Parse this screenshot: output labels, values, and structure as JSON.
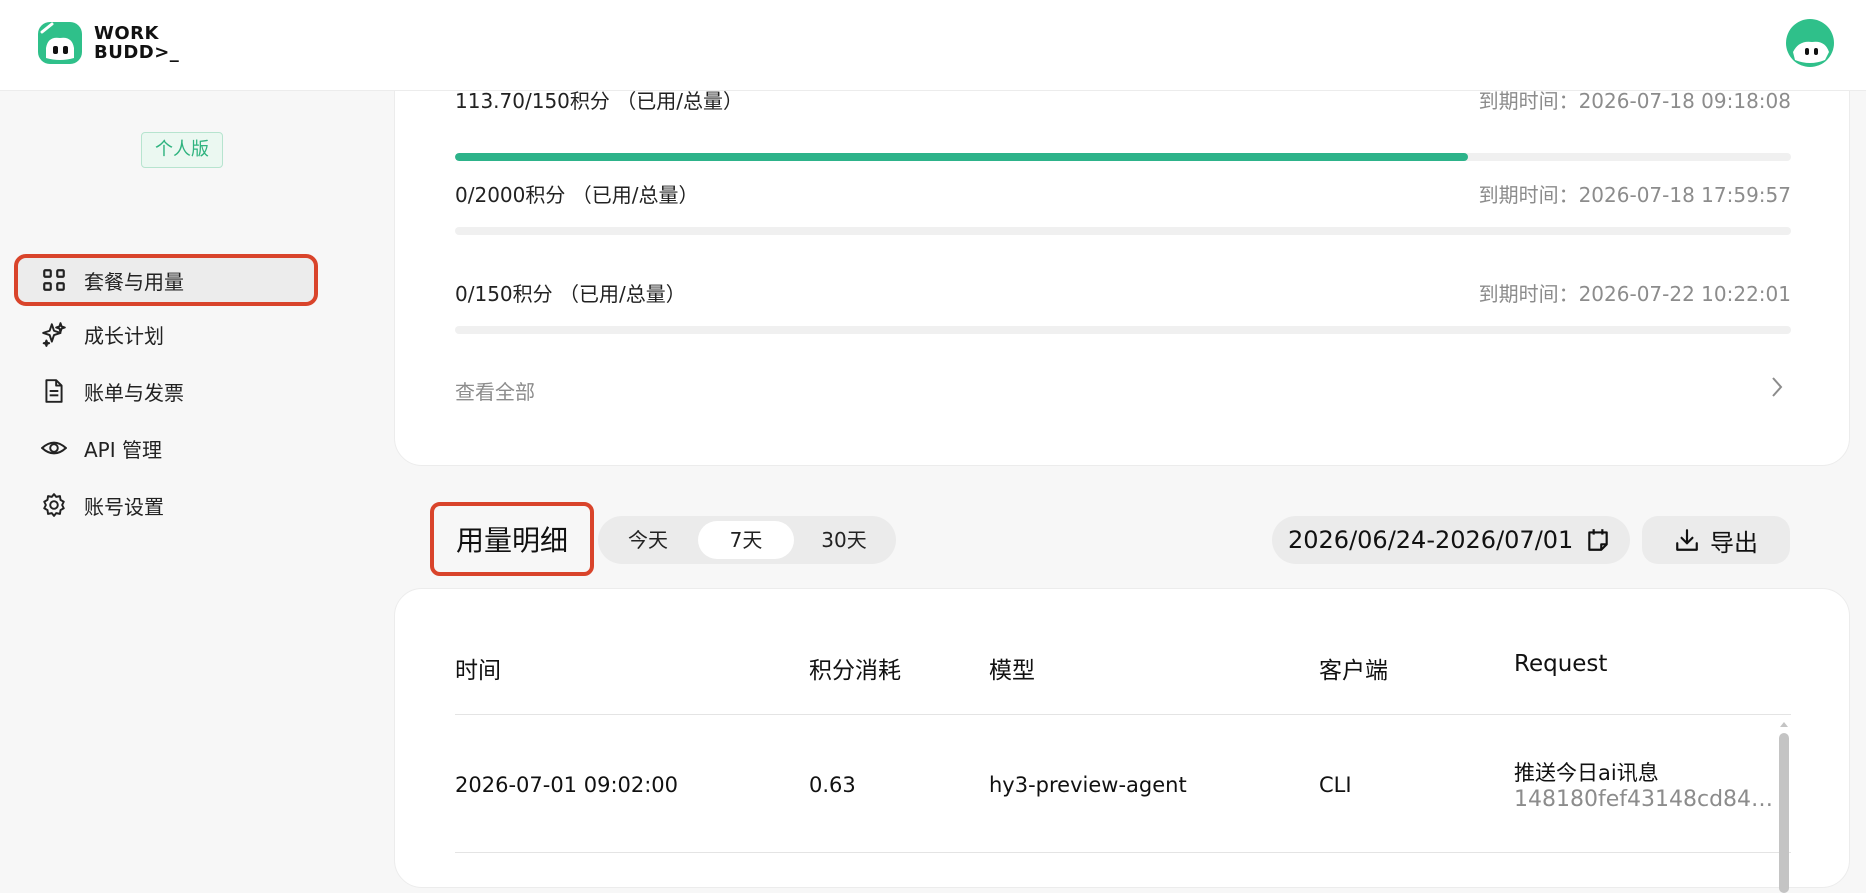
{
  "header": {
    "logo_line1": "WORK",
    "logo_line2": "BUDD>_",
    "brand_color": "#2fc08a"
  },
  "sidebar": {
    "plan_badge": "个人版",
    "items": [
      {
        "label": "套餐与用量",
        "icon": "grid-icon",
        "active": true
      },
      {
        "label": "成长计划",
        "icon": "sparkles-icon",
        "active": false
      },
      {
        "label": "账单与发票",
        "icon": "document-icon",
        "active": false
      },
      {
        "label": "API 管理",
        "icon": "eye-icon",
        "active": false
      },
      {
        "label": "账号设置",
        "icon": "gear-icon",
        "active": false
      }
    ]
  },
  "quotas": {
    "items": [
      {
        "label": "113.70/150积分 （已用/总量）",
        "expiry": "到期时间：2026-07-18 09:18:08",
        "used_fraction": 0.758
      },
      {
        "label": "0/2000积分 （已用/总量）",
        "expiry": "到期时间：2026-07-18 17:59:57",
        "used_fraction": 0
      },
      {
        "label": "0/150积分 （已用/总量）",
        "expiry": "到期时间：2026-07-22 10:22:01",
        "used_fraction": 0
      }
    ],
    "view_all": "查看全部",
    "progress_color": "#2db38a"
  },
  "usage": {
    "title": "用量明细",
    "ranges": [
      "今天",
      "7天",
      "30天"
    ],
    "selected_range": "7天",
    "date_range": "2026/06/24-2026/07/01",
    "export_label": "导出"
  },
  "table": {
    "columns": [
      "时间",
      "积分消耗",
      "模型",
      "客户端",
      "Request"
    ],
    "rows": [
      {
        "time": "2026-07-01 09:02:00",
        "credits": "0.63",
        "model": "hy3-preview-agent",
        "client": "CLI",
        "request_title": "推送今日ai讯息",
        "request_id": "148180fef43148cd84…"
      }
    ]
  },
  "accent_color": "#d9442b"
}
